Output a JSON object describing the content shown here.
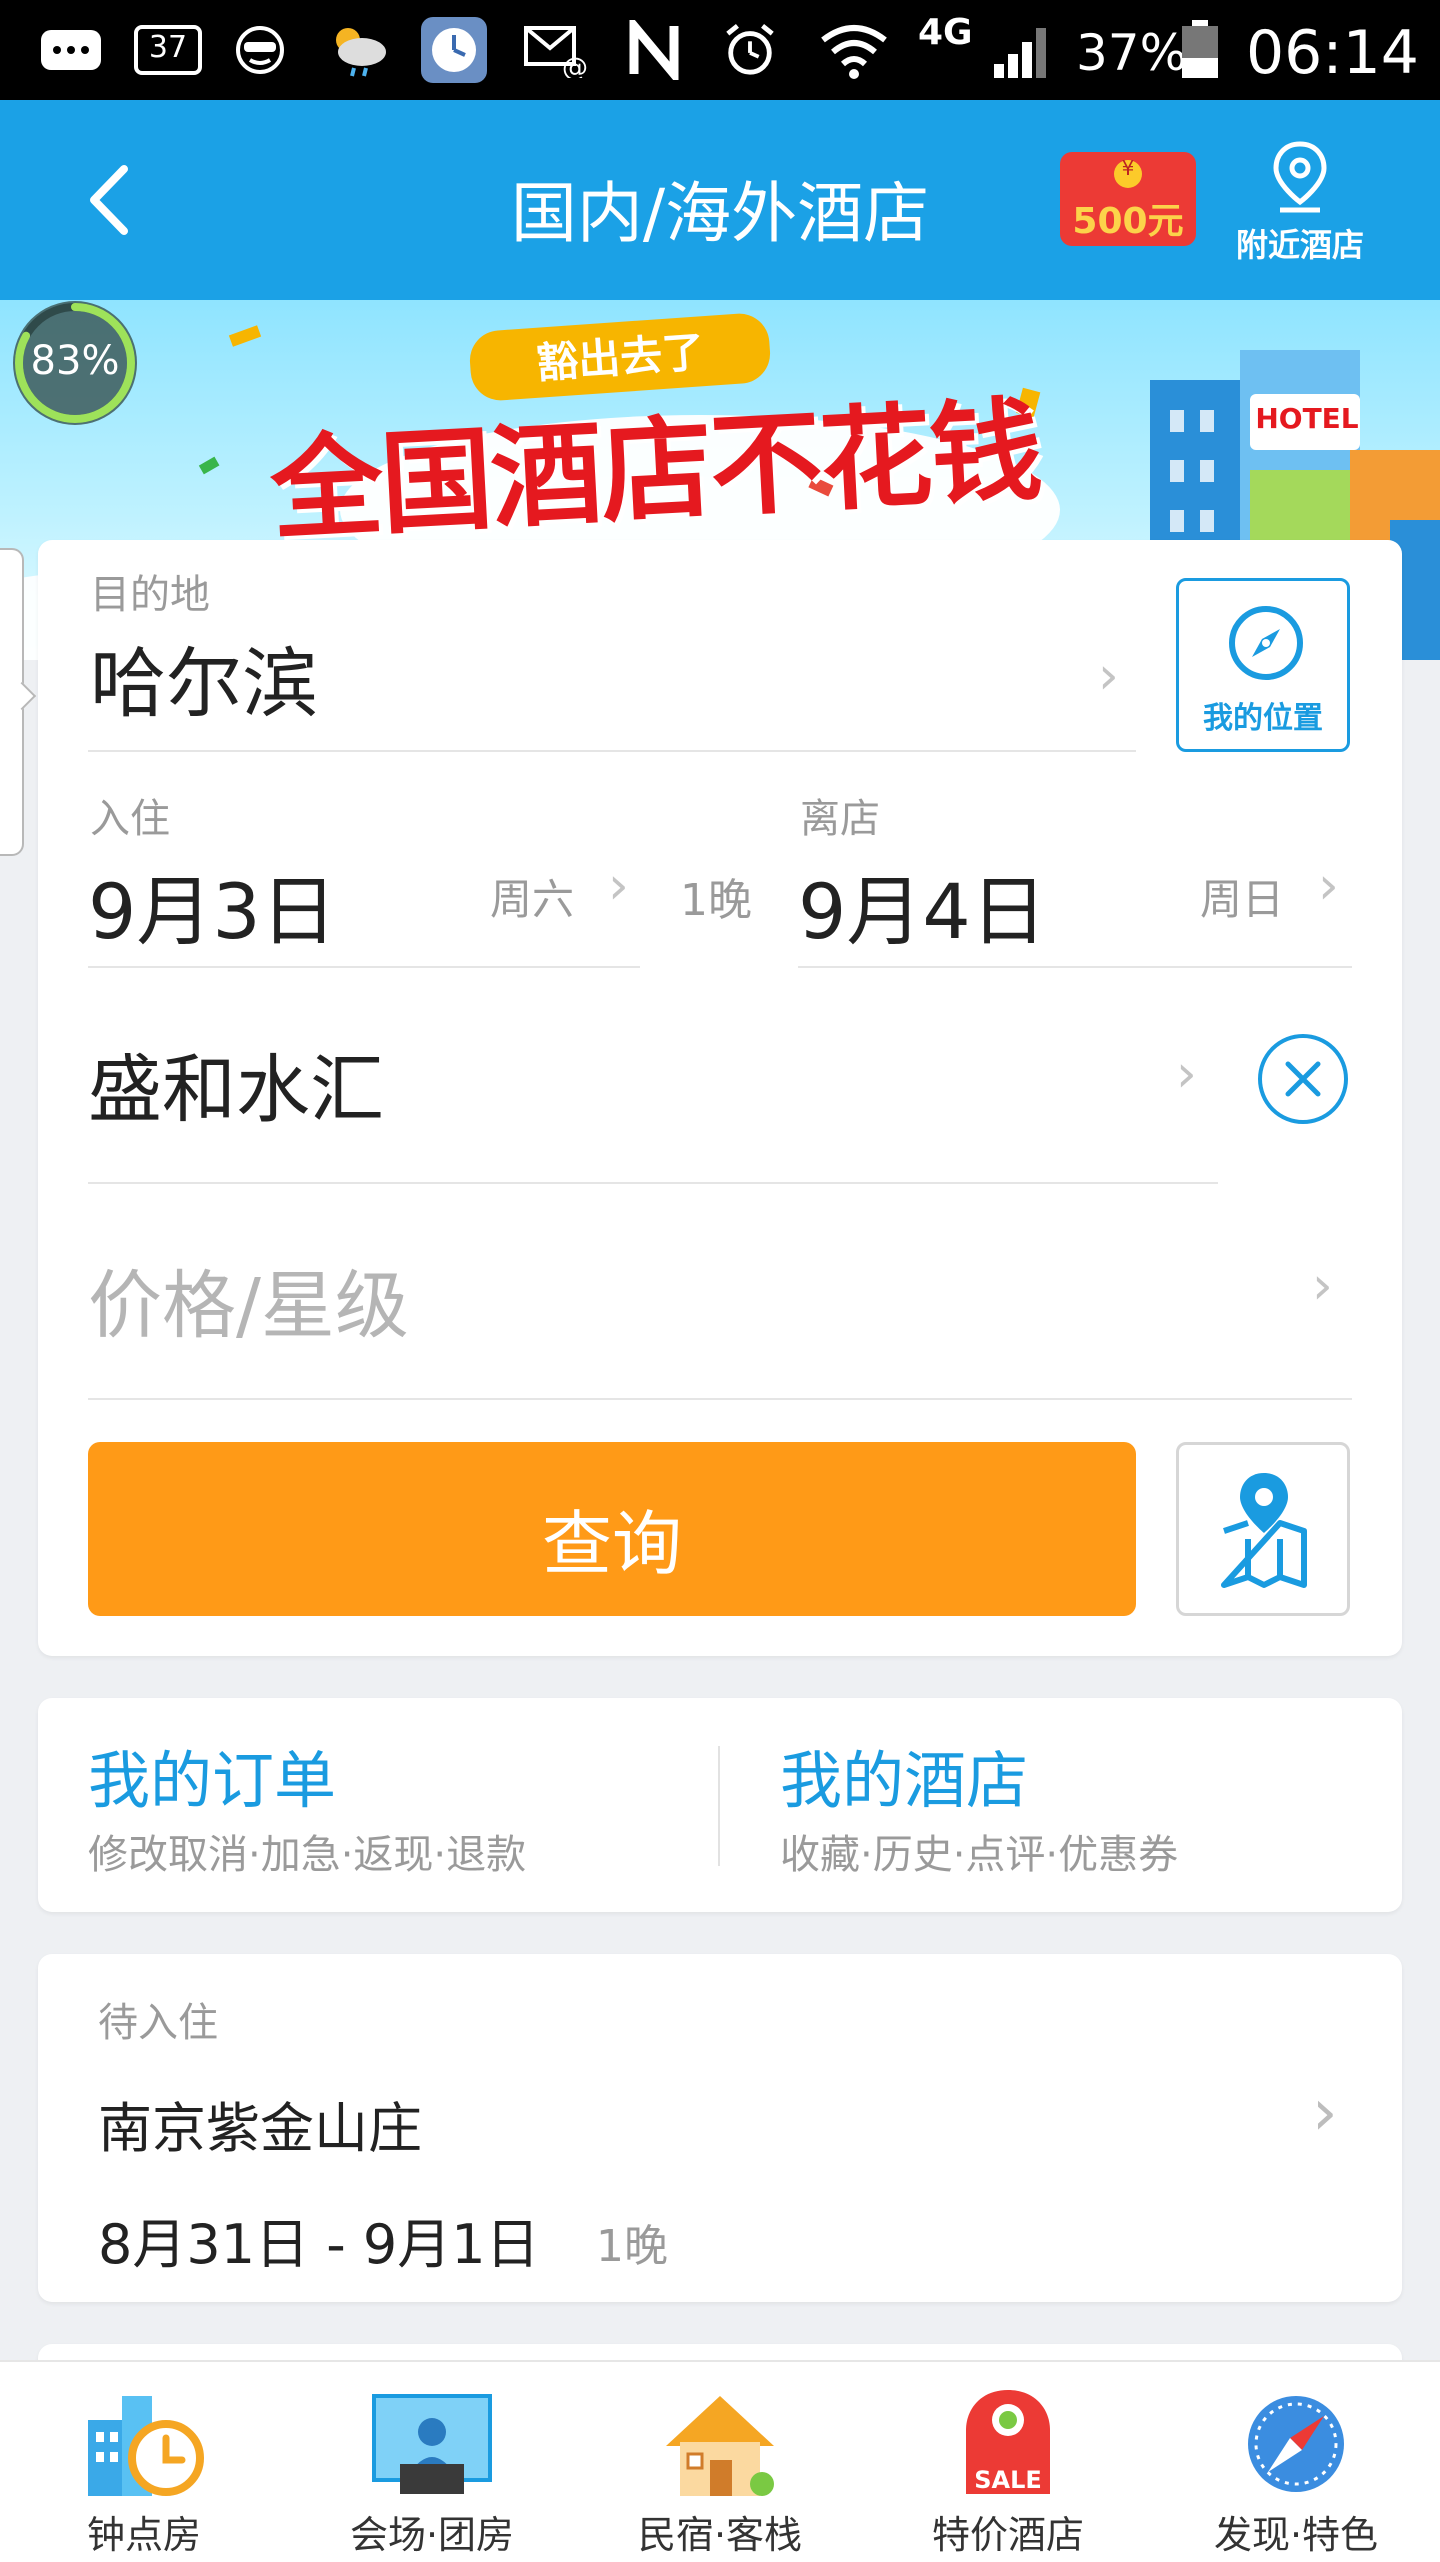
{
  "status_bar": {
    "badge_number": "37",
    "network": "4G",
    "battery": "37%",
    "time": "06:14"
  },
  "header": {
    "title": "国内/海外酒店",
    "red_packet_symbol": "¥",
    "red_packet_amount": "500元",
    "nearby_label": "附近酒店"
  },
  "banner": {
    "progress_label": "83%",
    "progress_value": 0.83,
    "tagline": "豁出去了",
    "headline": "全国酒店不花钱",
    "hotel_sign": "HOTEL"
  },
  "search_form": {
    "destination_label": "目的地",
    "destination_value": "哈尔滨",
    "my_location_label": "我的位置",
    "checkin_label": "入住",
    "checkin_date": "9月3日",
    "checkin_weekday": "周六",
    "nights": "1晚",
    "checkout_label": "离店",
    "checkout_date": "9月4日",
    "checkout_weekday": "周日",
    "keyword_value": "盛和水汇",
    "price_star_placeholder": "价格/星级",
    "search_button": "查询"
  },
  "shortcuts": {
    "orders_title": "我的订单",
    "orders_sub": "修改取消·加急·返现·退款",
    "hotels_title": "我的酒店",
    "hotels_sub": "收藏·历史·点评·优惠券"
  },
  "pending": {
    "status_label": "待入住",
    "hotel_name": "南京紫金山庄",
    "date_range": "8月31日 - 9月1日",
    "nights": "1晚"
  },
  "bottom_nav": [
    {
      "label": "钟点房",
      "icon": "hourly-room-icon"
    },
    {
      "label": "会场·团房",
      "icon": "conference-icon"
    },
    {
      "label": "民宿·客栈",
      "icon": "guesthouse-icon"
    },
    {
      "label": "特价酒店",
      "icon": "sale-tag-icon",
      "icon_text": "SALE"
    },
    {
      "label": "发现·特色",
      "icon": "compass-discover-icon"
    }
  ],
  "colors": {
    "primary_blue": "#1ba1e6",
    "accent_orange": "#ff9a17",
    "link_blue": "#1a9be0"
  }
}
